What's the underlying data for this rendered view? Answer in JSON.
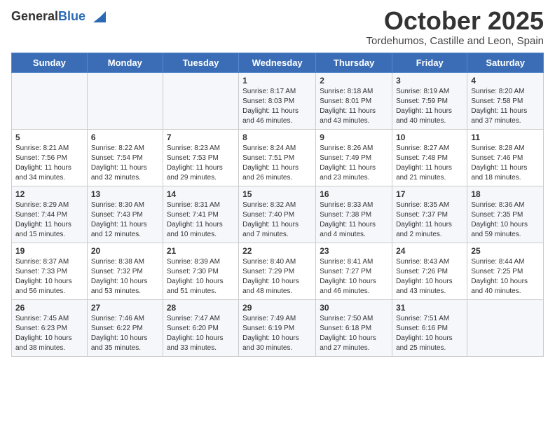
{
  "logo": {
    "general": "General",
    "blue": "Blue"
  },
  "header": {
    "title": "October 2025",
    "location": "Tordehumos, Castille and Leon, Spain"
  },
  "weekdays": [
    "Sunday",
    "Monday",
    "Tuesday",
    "Wednesday",
    "Thursday",
    "Friday",
    "Saturday"
  ],
  "weeks": [
    [
      {
        "day": "",
        "text": ""
      },
      {
        "day": "",
        "text": ""
      },
      {
        "day": "",
        "text": ""
      },
      {
        "day": "1",
        "text": "Sunrise: 8:17 AM\nSunset: 8:03 PM\nDaylight: 11 hours and 46 minutes."
      },
      {
        "day": "2",
        "text": "Sunrise: 8:18 AM\nSunset: 8:01 PM\nDaylight: 11 hours and 43 minutes."
      },
      {
        "day": "3",
        "text": "Sunrise: 8:19 AM\nSunset: 7:59 PM\nDaylight: 11 hours and 40 minutes."
      },
      {
        "day": "4",
        "text": "Sunrise: 8:20 AM\nSunset: 7:58 PM\nDaylight: 11 hours and 37 minutes."
      }
    ],
    [
      {
        "day": "5",
        "text": "Sunrise: 8:21 AM\nSunset: 7:56 PM\nDaylight: 11 hours and 34 minutes."
      },
      {
        "day": "6",
        "text": "Sunrise: 8:22 AM\nSunset: 7:54 PM\nDaylight: 11 hours and 32 minutes."
      },
      {
        "day": "7",
        "text": "Sunrise: 8:23 AM\nSunset: 7:53 PM\nDaylight: 11 hours and 29 minutes."
      },
      {
        "day": "8",
        "text": "Sunrise: 8:24 AM\nSunset: 7:51 PM\nDaylight: 11 hours and 26 minutes."
      },
      {
        "day": "9",
        "text": "Sunrise: 8:26 AM\nSunset: 7:49 PM\nDaylight: 11 hours and 23 minutes."
      },
      {
        "day": "10",
        "text": "Sunrise: 8:27 AM\nSunset: 7:48 PM\nDaylight: 11 hours and 21 minutes."
      },
      {
        "day": "11",
        "text": "Sunrise: 8:28 AM\nSunset: 7:46 PM\nDaylight: 11 hours and 18 minutes."
      }
    ],
    [
      {
        "day": "12",
        "text": "Sunrise: 8:29 AM\nSunset: 7:44 PM\nDaylight: 11 hours and 15 minutes."
      },
      {
        "day": "13",
        "text": "Sunrise: 8:30 AM\nSunset: 7:43 PM\nDaylight: 11 hours and 12 minutes."
      },
      {
        "day": "14",
        "text": "Sunrise: 8:31 AM\nSunset: 7:41 PM\nDaylight: 11 hours and 10 minutes."
      },
      {
        "day": "15",
        "text": "Sunrise: 8:32 AM\nSunset: 7:40 PM\nDaylight: 11 hours and 7 minutes."
      },
      {
        "day": "16",
        "text": "Sunrise: 8:33 AM\nSunset: 7:38 PM\nDaylight: 11 hours and 4 minutes."
      },
      {
        "day": "17",
        "text": "Sunrise: 8:35 AM\nSunset: 7:37 PM\nDaylight: 11 hours and 2 minutes."
      },
      {
        "day": "18",
        "text": "Sunrise: 8:36 AM\nSunset: 7:35 PM\nDaylight: 10 hours and 59 minutes."
      }
    ],
    [
      {
        "day": "19",
        "text": "Sunrise: 8:37 AM\nSunset: 7:33 PM\nDaylight: 10 hours and 56 minutes."
      },
      {
        "day": "20",
        "text": "Sunrise: 8:38 AM\nSunset: 7:32 PM\nDaylight: 10 hours and 53 minutes."
      },
      {
        "day": "21",
        "text": "Sunrise: 8:39 AM\nSunset: 7:30 PM\nDaylight: 10 hours and 51 minutes."
      },
      {
        "day": "22",
        "text": "Sunrise: 8:40 AM\nSunset: 7:29 PM\nDaylight: 10 hours and 48 minutes."
      },
      {
        "day": "23",
        "text": "Sunrise: 8:41 AM\nSunset: 7:27 PM\nDaylight: 10 hours and 46 minutes."
      },
      {
        "day": "24",
        "text": "Sunrise: 8:43 AM\nSunset: 7:26 PM\nDaylight: 10 hours and 43 minutes."
      },
      {
        "day": "25",
        "text": "Sunrise: 8:44 AM\nSunset: 7:25 PM\nDaylight: 10 hours and 40 minutes."
      }
    ],
    [
      {
        "day": "26",
        "text": "Sunrise: 7:45 AM\nSunset: 6:23 PM\nDaylight: 10 hours and 38 minutes."
      },
      {
        "day": "27",
        "text": "Sunrise: 7:46 AM\nSunset: 6:22 PM\nDaylight: 10 hours and 35 minutes."
      },
      {
        "day": "28",
        "text": "Sunrise: 7:47 AM\nSunset: 6:20 PM\nDaylight: 10 hours and 33 minutes."
      },
      {
        "day": "29",
        "text": "Sunrise: 7:49 AM\nSunset: 6:19 PM\nDaylight: 10 hours and 30 minutes."
      },
      {
        "day": "30",
        "text": "Sunrise: 7:50 AM\nSunset: 6:18 PM\nDaylight: 10 hours and 27 minutes."
      },
      {
        "day": "31",
        "text": "Sunrise: 7:51 AM\nSunset: 6:16 PM\nDaylight: 10 hours and 25 minutes."
      },
      {
        "day": "",
        "text": ""
      }
    ]
  ]
}
